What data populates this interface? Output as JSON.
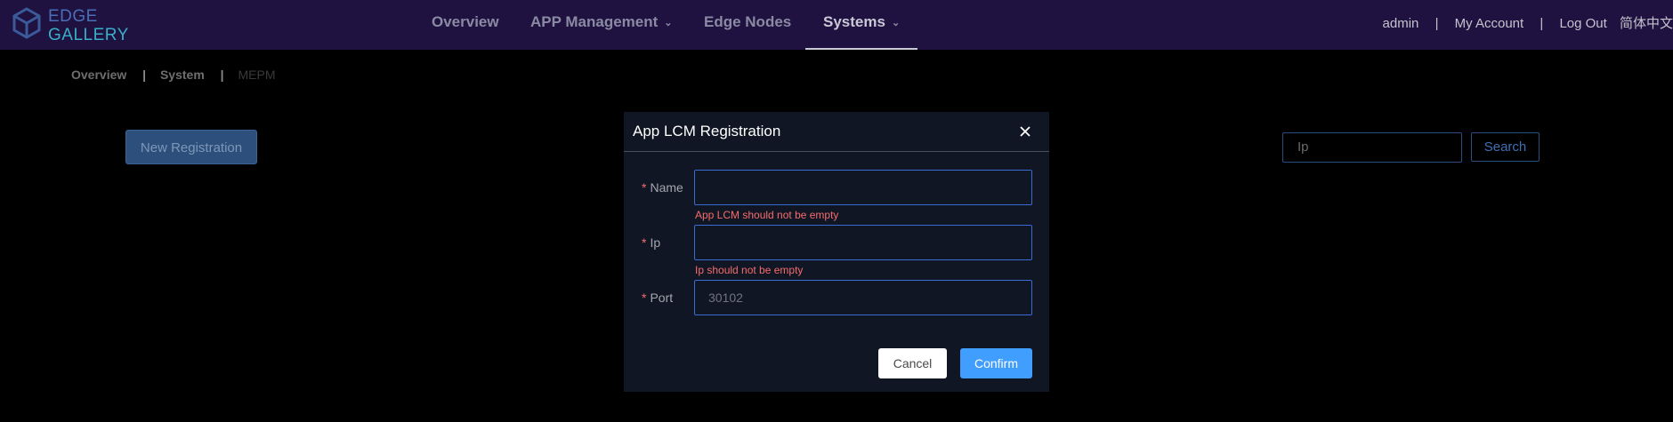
{
  "header": {
    "logo": {
      "line1": "EDGE",
      "line2": "GALLERY"
    },
    "nav": [
      {
        "label": "Overview",
        "has_dropdown": false,
        "active": false
      },
      {
        "label": "APP Management",
        "has_dropdown": true,
        "active": false
      },
      {
        "label": "Edge Nodes",
        "has_dropdown": false,
        "active": false
      },
      {
        "label": "Systems",
        "has_dropdown": true,
        "active": true
      }
    ],
    "user_links": {
      "user": "admin",
      "sep": "|",
      "account": "My Account",
      "logout": "Log Out",
      "language": "简体中文"
    }
  },
  "breadcrumb": {
    "items": [
      "Overview",
      "System",
      "MEPM"
    ],
    "sep": "|"
  },
  "toolbar": {
    "new_registration": "New Registration",
    "search_placeholder": "Ip",
    "search_button": "Search"
  },
  "modal": {
    "title": "App LCM Registration",
    "required_mark": "*",
    "fields": {
      "name": {
        "label": "Name",
        "value": "",
        "placeholder": "",
        "error": "App LCM should not be empty"
      },
      "ip": {
        "label": "Ip",
        "value": "",
        "placeholder": "",
        "error": "Ip should not be empty"
      },
      "port": {
        "label": "Port",
        "value": "30102",
        "placeholder": ""
      }
    },
    "cancel": "Cancel",
    "confirm": "Confirm"
  },
  "colors": {
    "header_bg": "#1f1140",
    "primary": "#409eff",
    "error": "#f56c6c"
  }
}
